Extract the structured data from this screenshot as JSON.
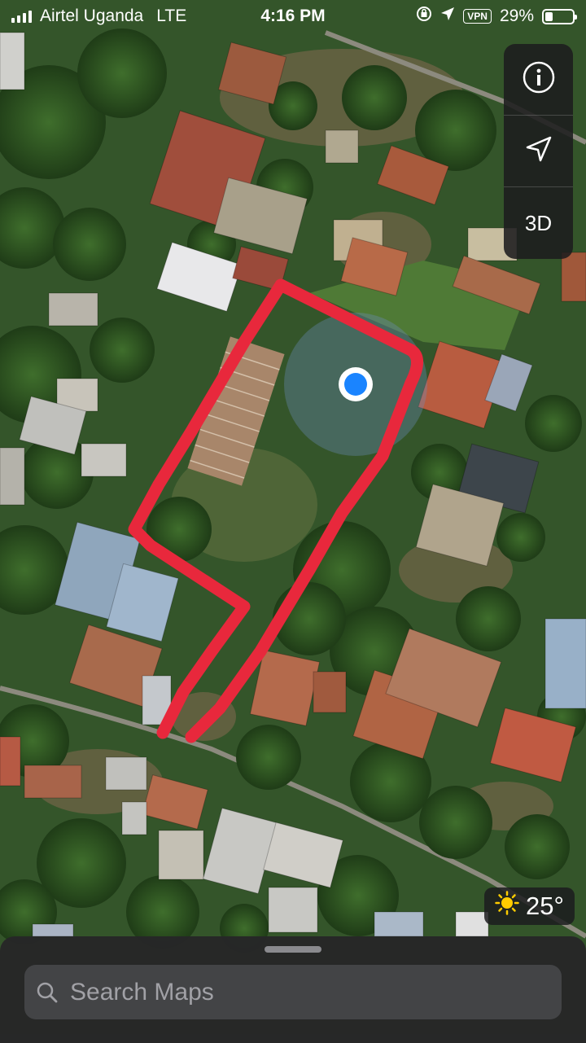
{
  "status_bar": {
    "carrier": "Airtel Uganda",
    "network": "LTE",
    "time": "4:16 PM",
    "vpn_label": "VPN",
    "battery_text": "29%",
    "battery_level": 0.29
  },
  "map_controls": {
    "info_icon": "info-icon",
    "locate_icon": "location-arrow-icon",
    "view_3d_label": "3D"
  },
  "weather": {
    "icon": "sun-icon",
    "temperature": "25°"
  },
  "search": {
    "placeholder": "Search Maps"
  },
  "colors": {
    "boundary": "#e8283c",
    "user_location": "#1a84ff"
  }
}
